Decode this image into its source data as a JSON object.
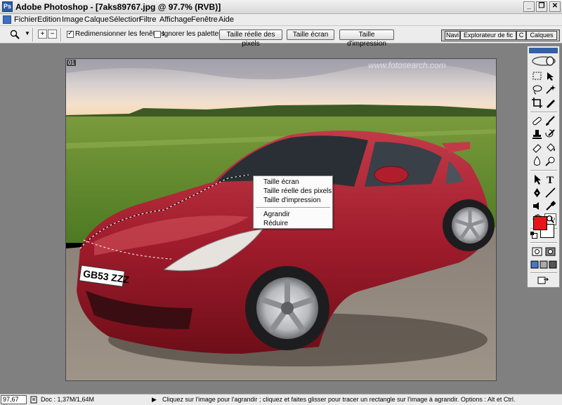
{
  "window": {
    "title": "Adobe Photoshop - [7aks89767.jpg @ 97.7% (RVB)]",
    "minimize": "_",
    "restore": "❐",
    "close": "✕"
  },
  "menu": [
    "Fichier",
    "Edition",
    "Image",
    "Calque",
    "Sélection",
    "Filtre",
    "Affichage",
    "Fenêtre",
    "Aide"
  ],
  "options": {
    "resize_windows_label": "Redimensionner les fenêtres",
    "resize_windows_checked": true,
    "ignore_palettes_label": "Ignorer les palettes",
    "ignore_palettes_checked": false,
    "actual_pixels": "Taille réelle des pixels",
    "fit_screen": "Taille écran",
    "print_size": "Taille d'impression",
    "palette_tabs": [
      "Navi",
      "Explorateur de fic",
      "C",
      "Calques"
    ]
  },
  "document": {
    "corner_tab": "01",
    "watermark": "www.fotosearch.com"
  },
  "context_menu": {
    "items": [
      "Taille écran",
      "Taille réelle des pixels",
      "Taille d'impression",
      "Agrandir",
      "Réduire"
    ]
  },
  "toolbox": {
    "foreground_color": "#e8131b",
    "background_color": "#ffffff",
    "tools": [
      "marquee-icon",
      "move-icon",
      "lasso-icon",
      "magic-wand-icon",
      "crop-icon",
      "slice-icon",
      "healing-icon",
      "brush-icon",
      "stamp-icon",
      "history-brush-icon",
      "eraser-icon",
      "paint-bucket-icon",
      "blur-icon",
      "dodge-icon",
      "path-select-icon",
      "type-icon",
      "pen-icon",
      "line-icon",
      "notes-icon",
      "eyedropper-icon",
      "hand-icon",
      "zoom-icon"
    ]
  },
  "status": {
    "zoom": "97,67 %",
    "doc": "Doc : 1,37M/1,64M",
    "hint": "Cliquez sur l'image pour l'agrandir ; cliquez et faites glisser pour tracer un rectangle sur l'image à agrandir. Options : Alt et Ctrl."
  }
}
